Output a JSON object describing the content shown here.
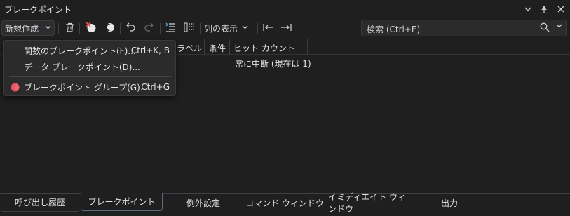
{
  "window": {
    "title": "ブレークポイント"
  },
  "toolbar": {
    "new_label": "新規作成",
    "columns_label": "列の表示"
  },
  "search": {
    "placeholder": "検索 (Ctrl+E)"
  },
  "grid": {
    "headers": [
      "ラベル",
      "条件",
      "ヒット カウント"
    ],
    "rows": [
      {
        "hit_count": "常に中断 (現在は 1)"
      }
    ]
  },
  "menu": {
    "items": [
      {
        "label": "関数のブレークポイント(F)...",
        "shortcut": "Ctrl+K, B"
      },
      {
        "label": "データ ブレークポイント(D)...",
        "shortcut": ""
      },
      {
        "label": "ブレークポイント グループ(G)...",
        "shortcut": "Ctrl+G"
      }
    ]
  },
  "tabs": [
    {
      "label": "呼び出し履歴"
    },
    {
      "label": "ブレークポイント"
    },
    {
      "label": "例外設定"
    },
    {
      "label": "コマンド ウィンドウ"
    },
    {
      "label": "イミディエイト ウィンドウ"
    },
    {
      "label": "出力"
    }
  ],
  "colors": {
    "background": "#1f1f1f",
    "breakpoint_red": "#e5515d",
    "active_tab_border": "#5f6b7a"
  }
}
